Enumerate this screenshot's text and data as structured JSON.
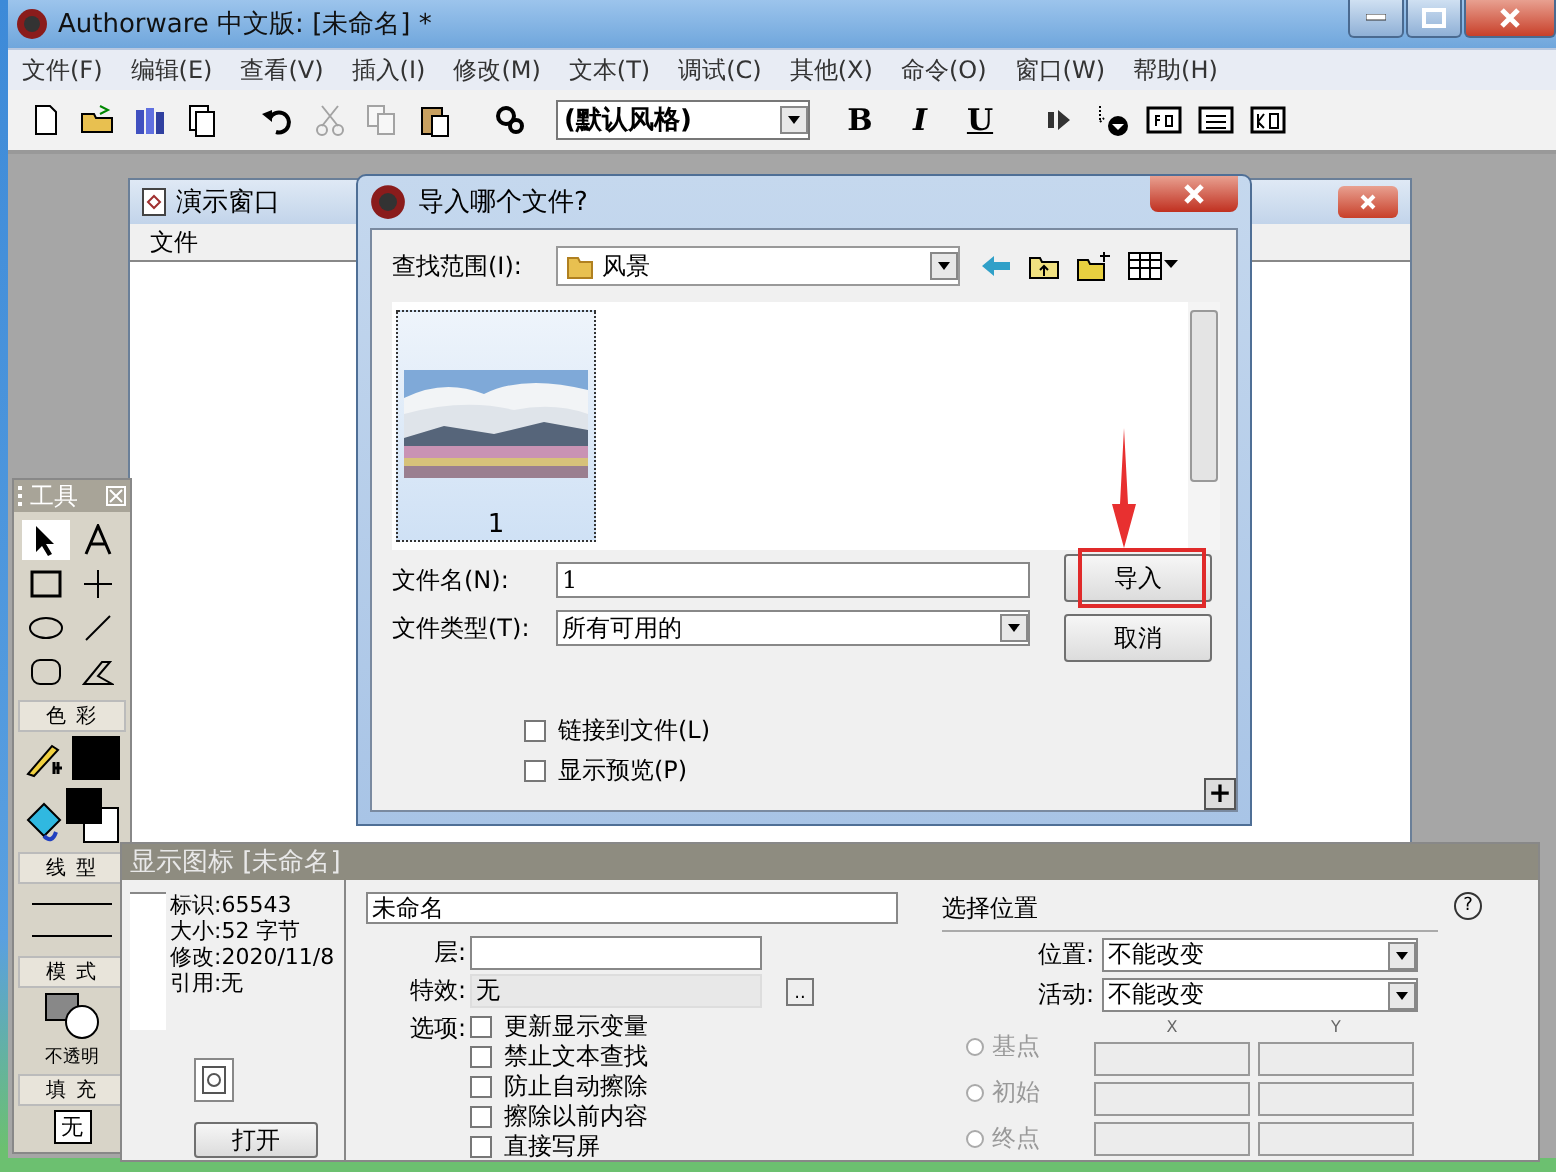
{
  "window": {
    "title": "Authorware 中文版: [未命名] *"
  },
  "menu": [
    "文件(F)",
    "编辑(E)",
    "查看(V)",
    "插入(I)",
    "修改(M)",
    "文本(T)",
    "调试(C)",
    "其他(X)",
    "命令(O)",
    "窗口(W)",
    "帮助(H)"
  ],
  "toolbar": {
    "style_select": "(默认风格)",
    "bold": "B",
    "italic": "I",
    "underline": "U"
  },
  "presentation_window": {
    "title": "演示窗口",
    "menu": [
      "文件"
    ]
  },
  "import_dialog": {
    "title": "导入哪个文件?",
    "look_in_label": "查找范围(I):",
    "look_in_value": "风景",
    "files": [
      {
        "name": "1",
        "selected": true,
        "kind": "picture"
      }
    ],
    "file_name_label": "文件名(N):",
    "file_name_value": "1",
    "file_type_label": "文件类型(T):",
    "file_type_value": "所有可用的",
    "buttons": [
      "导入",
      "取消"
    ],
    "options": [
      {
        "label": "链接到文件(L)",
        "checked": false
      },
      {
        "label": "显示预览(P)",
        "checked": false
      }
    ],
    "expand_button": "+"
  },
  "tools_panel": {
    "title": "工具",
    "sections": [
      "色 彩",
      "线 型",
      "模 式",
      "填 充"
    ],
    "mode_label": "不透明",
    "fill_value": "无"
  },
  "properties": {
    "title": "显示图标 [未命名]",
    "info": [
      "标识:65543",
      "大小:52 字节",
      "修改:2020/11/8",
      "引用:无"
    ],
    "open_button": "打开",
    "name_value": "未命名",
    "layer_label": "层:",
    "effect_label": "特效:",
    "effect_value": "无",
    "effect_button": "..",
    "options_label": "选项:",
    "options": [
      {
        "label": "更新显示变量",
        "checked": false
      },
      {
        "label": "禁止文本查找",
        "checked": false
      },
      {
        "label": "防止自动擦除",
        "checked": false
      },
      {
        "label": "擦除以前内容",
        "checked": false
      },
      {
        "label": "直接写屏",
        "checked": false
      }
    ],
    "position_heading": "选择位置",
    "position_label": "位置:",
    "position_value": "不能改变",
    "motion_label": "活动:",
    "motion_value": "不能改变",
    "x_label": "X",
    "y_label": "Y",
    "coords": [
      {
        "label": "基点",
        "selected": false,
        "disabled": true
      },
      {
        "label": "初始",
        "selected": false,
        "disabled": true
      },
      {
        "label": "终点",
        "selected": false,
        "disabled": true
      }
    ],
    "help": "?"
  }
}
